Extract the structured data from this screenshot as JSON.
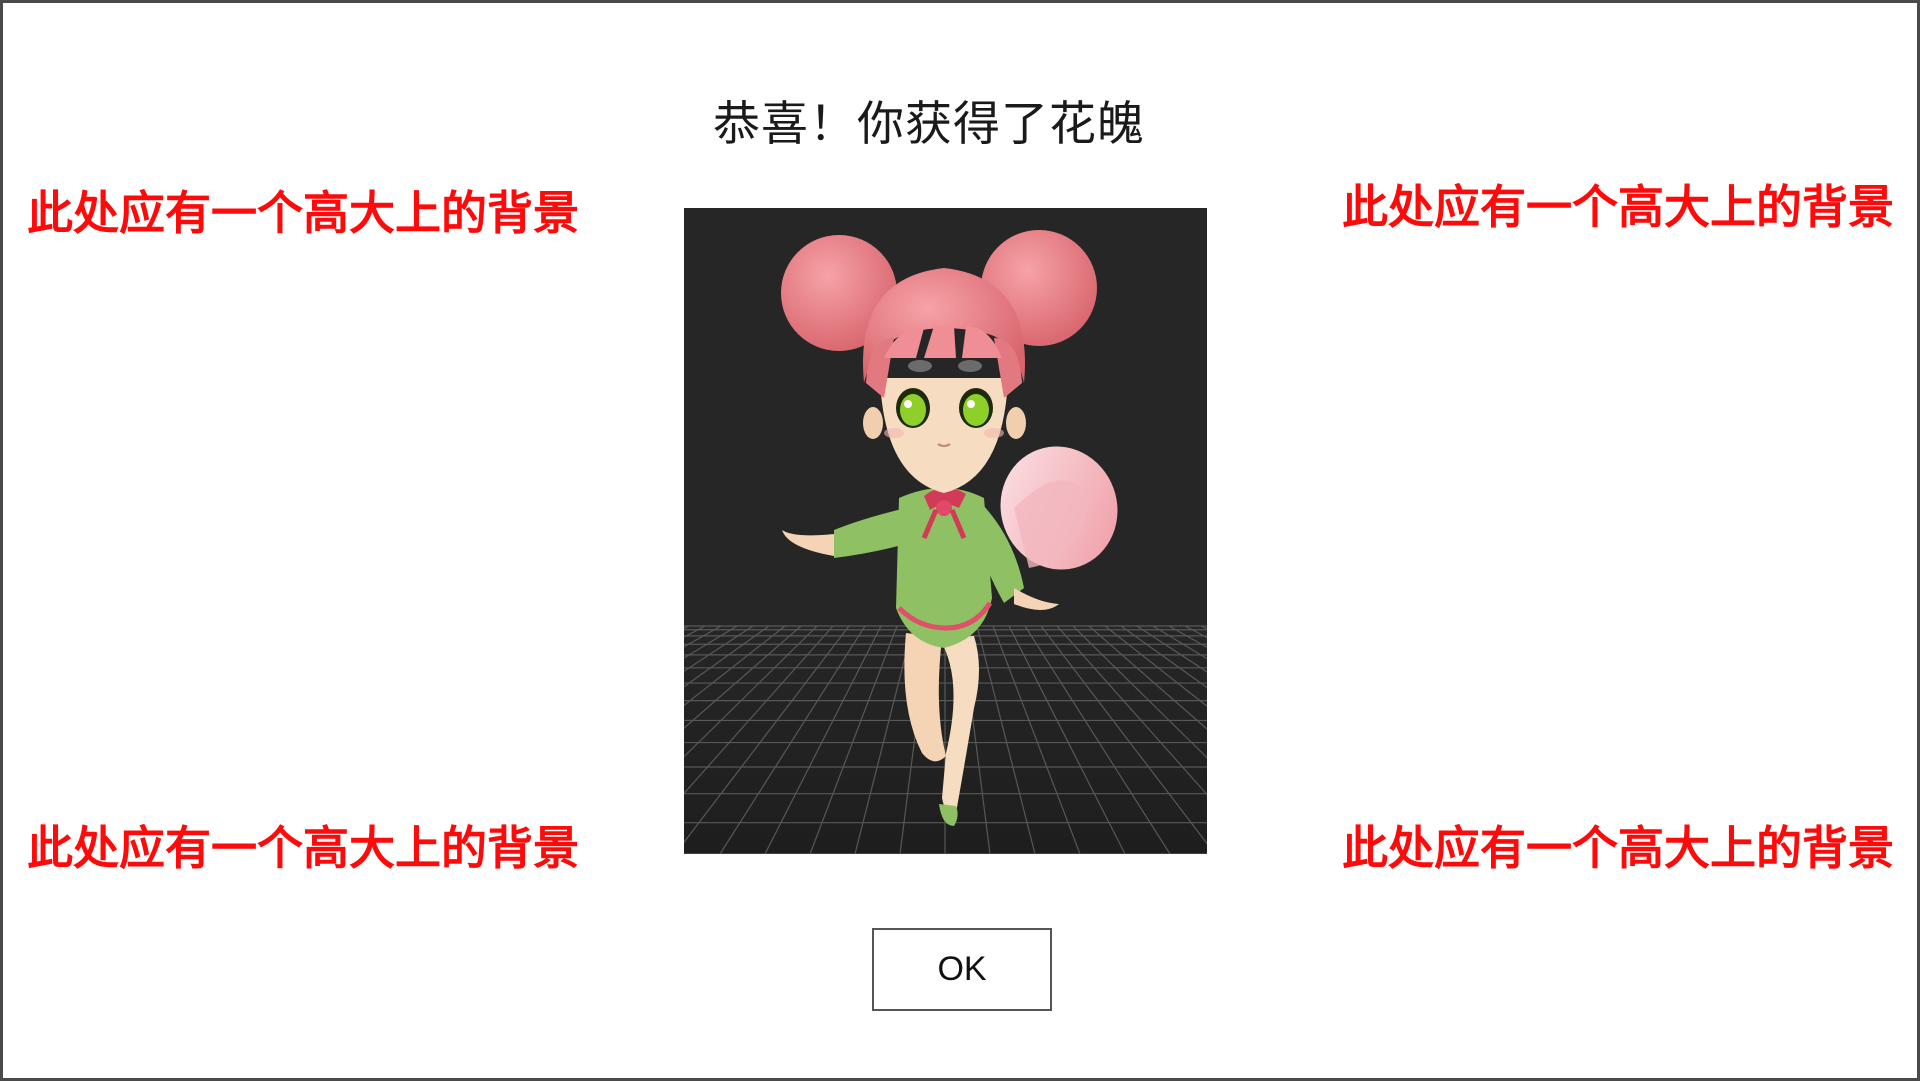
{
  "dialog": {
    "title": "恭喜！你获得了花魄",
    "ok_label": "OK"
  },
  "placeholders": {
    "top_left": "此处应有一个高大上的背景",
    "top_right": "此处应有一个高大上的背景",
    "bottom_left": "此处应有一个高大上的背景",
    "bottom_right": "此处应有一个高大上的背景"
  },
  "colors": {
    "placeholder_text": "#ff0a0a",
    "portrait_background": "#262626",
    "hair": "#ee7f86",
    "dress": "#8fc063",
    "skin": "#f6dcc0",
    "eyes": "#8fcf2a"
  },
  "icons": {
    "character": "hua-po-character-portrait"
  }
}
